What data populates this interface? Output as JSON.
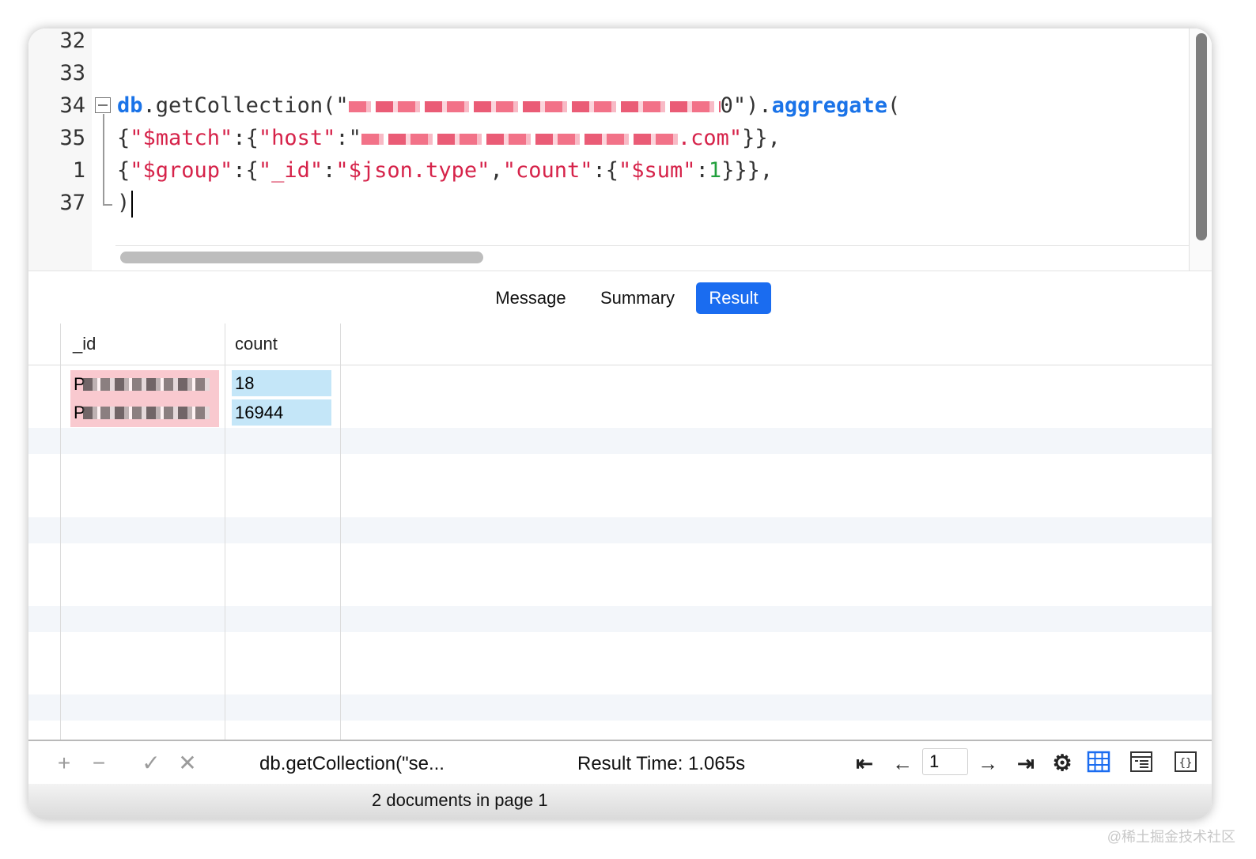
{
  "editor": {
    "lines": [
      {
        "num": "32"
      },
      {
        "num": "33"
      },
      {
        "num": "34",
        "db": "db",
        "dot1": ".",
        "method": "getCollection(\"",
        "redacted_tail": "0\")",
        "dot2": ".",
        "aggregate": "aggregate",
        "paren": "("
      },
      {
        "num": "35",
        "open": "{",
        "key1": "\"$match\"",
        "colon1": ":{",
        "key2": "\"host\"",
        "colon2": ":\"",
        "tail": ".com\"",
        "close": "}},"
      },
      {
        "num": "1",
        "open": "{",
        "key1": "\"$group\"",
        "colon1": ":{",
        "key2": "\"_id\"",
        "colon2": ":",
        "val2": "\"$json.type\"",
        "comma": ",",
        "key3": "\"count\"",
        "colon3": ":{",
        "key4": "\"$sum\"",
        "colon4": ":",
        "close": "}}},"
      },
      {
        "num": "37",
        "close": ")"
      }
    ]
  },
  "tabs": [
    {
      "label": "Message",
      "active": false
    },
    {
      "label": "Summary",
      "active": false
    },
    {
      "label": "Result",
      "active": true
    }
  ],
  "grid": {
    "columns": [
      "_id",
      "count"
    ],
    "rows": [
      {
        "id": "P",
        "count": "18"
      },
      {
        "id": "P",
        "count": "16944"
      }
    ]
  },
  "toolbar": {
    "add": "+",
    "remove": "−",
    "apply": "✓",
    "discard": "✕",
    "query": "db.getCollection(\"se...",
    "result_time": "Result Time: 1.065s",
    "page": "1"
  },
  "status": {
    "text": "2 documents in page 1"
  },
  "watermark": "@稀土掘金技术社区",
  "colors": {
    "accent": "#1a6cf0",
    "keyword": "#1a73e8",
    "string": "#d6234a",
    "number": "#22a03d",
    "id_cell": "#f9c9cf",
    "count_cell": "#c4e6f8"
  }
}
